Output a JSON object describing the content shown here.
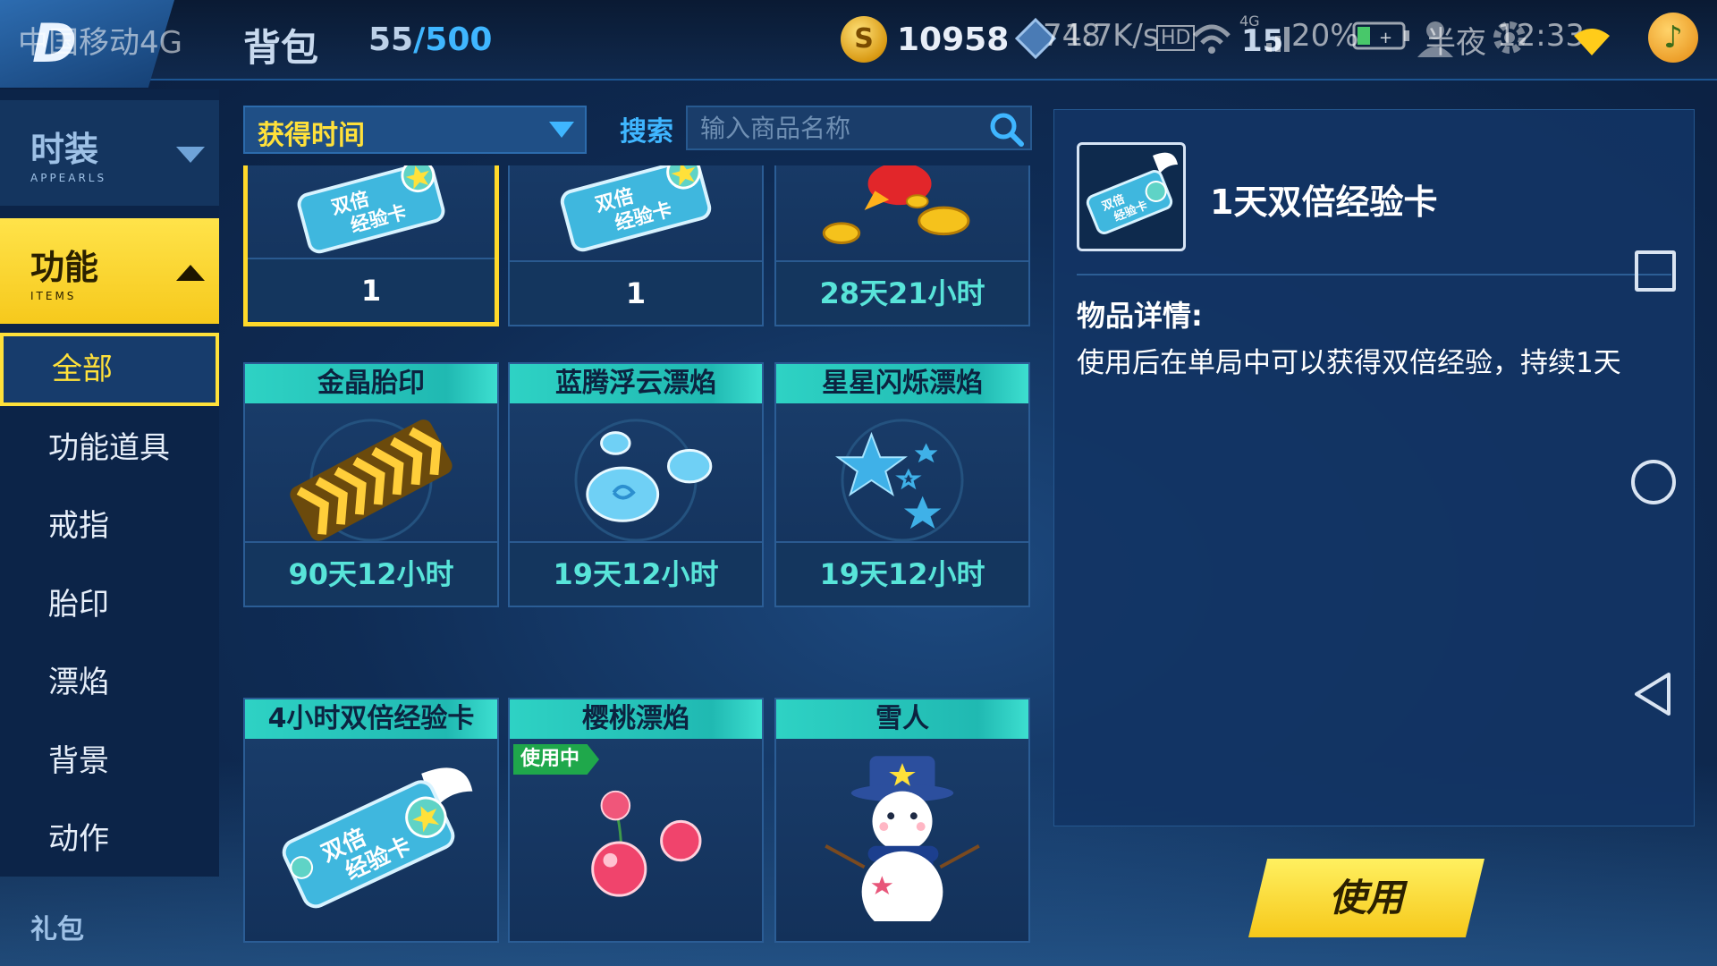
{
  "status_bar": {
    "carrier": "中国移动4G",
    "network_speed": "1.7K/s",
    "signal_text": "4G",
    "battery": "20%",
    "period": "半夜",
    "time": "12:33"
  },
  "header": {
    "title": "背包",
    "capacity_used": "55",
    "capacity_sep": "/",
    "capacity_max": "500",
    "coins": "10958",
    "misc_counter": "748",
    "misc_counter2": "15"
  },
  "sidebar": {
    "categories": [
      {
        "label": "时装",
        "sub": "APPEARLS",
        "expanded": false
      },
      {
        "label": "功能",
        "sub": "ITEMS",
        "expanded": true
      }
    ],
    "subitems": [
      "全部",
      "功能道具",
      "戒指",
      "胎印",
      "漂焰",
      "背景",
      "动作"
    ],
    "active_subitem": "全部",
    "next_category": "礼包"
  },
  "filter": {
    "sort_label": "获得时间",
    "search_label": "搜索",
    "search_placeholder": "输入商品名称"
  },
  "items": [
    {
      "name": "",
      "footer": "1",
      "art": "double-exp-card-icon",
      "selected": true
    },
    {
      "name": "",
      "footer": "1",
      "art": "double-exp-card-icon",
      "selected": false
    },
    {
      "name": "",
      "footer": "28天21小时",
      "art": "red-bird-gold-icon",
      "selected": false
    },
    {
      "name": "金晶胎印",
      "footer": "90天12小时",
      "art": "gold-tire-print-icon",
      "selected": false
    },
    {
      "name": "蓝腾浮云漂焰",
      "footer": "19天12小时",
      "art": "blue-cloud-icon",
      "selected": false
    },
    {
      "name": "星星闪烁漂焰",
      "footer": "19天12小时",
      "art": "blue-stars-icon",
      "selected": false
    },
    {
      "name": "4小时双倍经验卡",
      "footer": "",
      "art": "double-exp-card-icon",
      "selected": false
    },
    {
      "name": "樱桃漂焰",
      "footer": "",
      "art": "cherry-icon",
      "selected": false,
      "badge": "使用中"
    },
    {
      "name": "雪人",
      "footer": "",
      "art": "snowman-icon",
      "selected": false
    }
  ],
  "card_label": {
    "line1": "双倍",
    "line2": "经验卡"
  },
  "detail": {
    "title": "1天双倍经验卡",
    "heading": "物品详情:",
    "description": "使用后在单局中可以获得双倍经验，持续1天",
    "use_button": "使用"
  },
  "colors": {
    "accent_yellow": "#ffe13a",
    "teal_label": "#2ed2c4",
    "blue_text": "#3fb6ff",
    "panel_bg": "#123464"
  }
}
